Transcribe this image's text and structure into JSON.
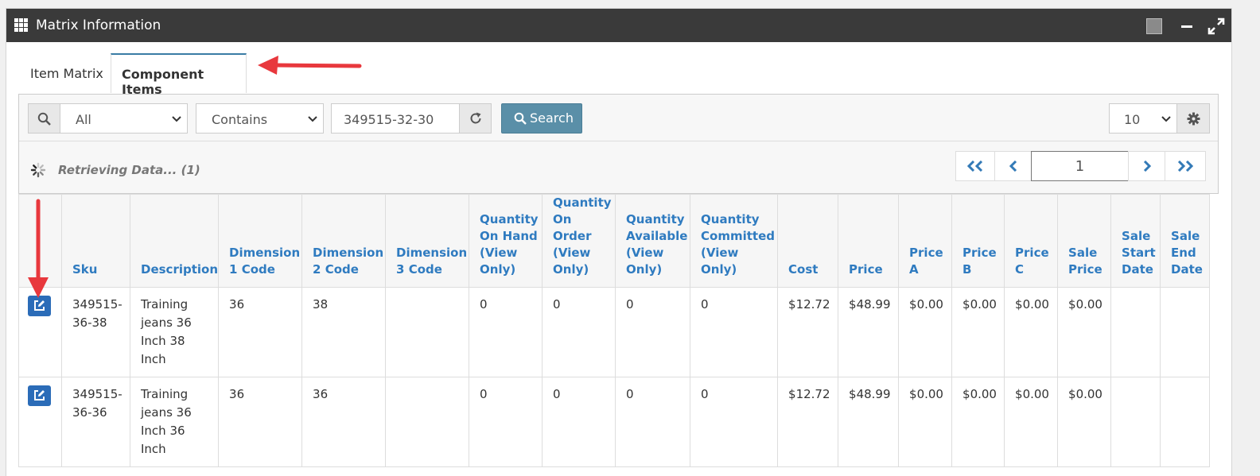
{
  "window": {
    "title": "Matrix Information",
    "icons": [
      "grid-icon",
      "square-icon",
      "minimize-icon",
      "expand-icon"
    ]
  },
  "tabs": [
    {
      "label": "Item Matrix",
      "active": false
    },
    {
      "label": "Component Items",
      "active": true
    }
  ],
  "toolbar": {
    "field_select": "All",
    "operator_select": "Contains",
    "search_value": "349515-32-30",
    "search_label": "Search",
    "page_size": "10"
  },
  "status": {
    "text": "Retrieving Data... (1)"
  },
  "pager": {
    "current_page": "1"
  },
  "table": {
    "columns": [
      {
        "line1": "Sku"
      },
      {
        "line1": "Description"
      },
      {
        "line1": "Dimension",
        "line2": "1 Code"
      },
      {
        "line1": "Dimension",
        "line2": "2 Code"
      },
      {
        "line1": "Dimension",
        "line2": "3 Code"
      },
      {
        "line1": "Quantity",
        "line2": "On Hand",
        "line3": "(View",
        "line4": "Only)"
      },
      {
        "line1": "Quantity",
        "line2": "On",
        "line3": "Order",
        "line4": "(View",
        "line5": "Only)"
      },
      {
        "line1": "Quantity",
        "line2": "Available",
        "line3": "(View",
        "line4": "Only)"
      },
      {
        "line1": "Quantity",
        "line2": "Committed",
        "line3": "(View",
        "line4": "Only)"
      },
      {
        "line1": "Cost"
      },
      {
        "line1": "Price"
      },
      {
        "line1": "Price",
        "line2": "A"
      },
      {
        "line1": "Price",
        "line2": "B"
      },
      {
        "line1": "Price",
        "line2": "C"
      },
      {
        "line1": "Sale",
        "line2": "Price"
      },
      {
        "line1": "Sale",
        "line2": "Start",
        "line3": "Date"
      },
      {
        "line1": "Sale",
        "line2": "End",
        "line3": "Date"
      }
    ],
    "rows": [
      {
        "sku_a": "349515-",
        "sku_b": "36-38",
        "desc_a": "Training",
        "desc_b": "jeans 36",
        "desc_c": "Inch 38",
        "desc_d": "Inch",
        "dim1": "36",
        "dim2": "38",
        "dim3": "",
        "qoh": "0",
        "qoo": "0",
        "qav": "0",
        "qcm": "0",
        "cost": "$12.72",
        "price": "$48.99",
        "price_a": "$0.00",
        "price_b": "$0.00",
        "price_c": "$0.00",
        "sale_price": "$0.00",
        "sale_start": "",
        "sale_end": ""
      },
      {
        "sku_a": "349515-",
        "sku_b": "36-36",
        "desc_a": "Training",
        "desc_b": "jeans 36",
        "desc_c": "Inch 36",
        "desc_d": "Inch",
        "dim1": "36",
        "dim2": "36",
        "dim3": "",
        "qoh": "0",
        "qoo": "0",
        "qav": "0",
        "qcm": "0",
        "cost": "$12.72",
        "price": "$48.99",
        "price_a": "$0.00",
        "price_b": "$0.00",
        "price_c": "$0.00",
        "sale_price": "$0.00",
        "sale_start": "",
        "sale_end": ""
      }
    ]
  },
  "annotation_color": "#e8383d"
}
